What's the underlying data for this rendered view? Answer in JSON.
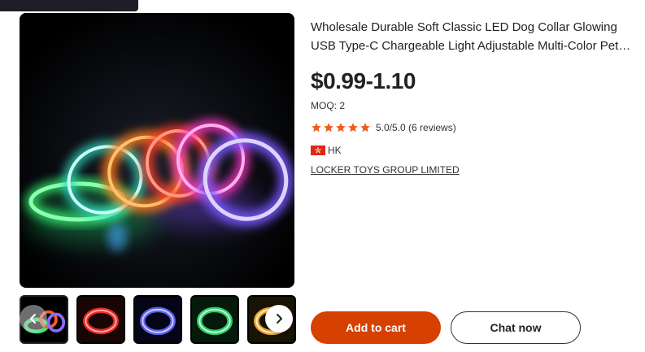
{
  "product": {
    "title": "Wholesale Durable Soft Classic LED Dog Collar Glowing USB Type-C Chargeable Light Adjustable Multi-Color Pet Collar",
    "price": "$0.99-1.10",
    "moq": "MOQ: 2",
    "rating": {
      "stars": 5,
      "text": "5.0/5.0 (6 reviews)"
    },
    "origin": "HK",
    "supplier": "LOCKER TOYS GROUP LIMITED"
  },
  "gallery": {
    "main_image": "led-dog-collars-photo",
    "thumbnails": [
      {
        "name": "multi-color-collars",
        "color": "#40d070",
        "active": true
      },
      {
        "name": "red-collar",
        "color": "#ff3030"
      },
      {
        "name": "blue-collar",
        "color": "#6a6aff"
      },
      {
        "name": "green-collar",
        "color": "#38e07a"
      },
      {
        "name": "yellow-collar",
        "color": "#ffb838"
      }
    ]
  },
  "actions": {
    "add_to_cart": "Add to cart",
    "chat_now": "Chat now"
  },
  "colors": {
    "accent": "#d64000",
    "star": "#ef5a1c"
  }
}
